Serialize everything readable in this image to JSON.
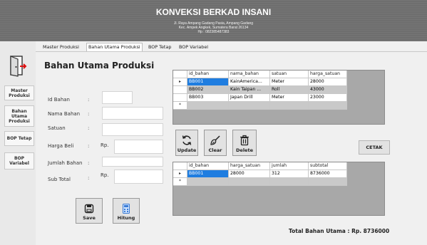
{
  "header": {
    "title": "KONVEKSI BERKAD INSANI",
    "address1": "Jl. Raya Ampang Gadang Pasia, Ampang Gadang",
    "address2": "Kec. Ampek Angkek, Sumatera Barat 26134",
    "phone": "Hp : 082385487383"
  },
  "tabs": [
    {
      "label": "Master Produksi"
    },
    {
      "label": "Bahan Utama Produksi"
    },
    {
      "label": "BOP Tetap"
    },
    {
      "label": "BOP Variabel"
    }
  ],
  "sidebar": {
    "exit_icon": "exit-door-icon",
    "items": [
      {
        "label": "Master Produksi"
      },
      {
        "label": "Bahan Utama Produksi"
      },
      {
        "label": "BOP Tetap"
      },
      {
        "label": "BOP Variabel"
      }
    ]
  },
  "form": {
    "title": "Bahan Utama Produksi",
    "fields": {
      "id_bahan": {
        "label": "Id Bahan",
        "value": ""
      },
      "nama_bahan": {
        "label": "Nama Bahan",
        "value": ""
      },
      "satuan": {
        "label": "Satuan",
        "value": ""
      },
      "harga_beli": {
        "label": "Harga Beli",
        "prefix": "Rp.",
        "value": ""
      },
      "jumlah_bahan": {
        "label": "Jumlah Bahan",
        "value": ""
      },
      "sub_total": {
        "label": "Sub Total",
        "prefix": "Rp.",
        "value": ""
      }
    },
    "colon": ":"
  },
  "buttons": {
    "save": {
      "label": "Save",
      "icon": "save-icon"
    },
    "hitung": {
      "label": "Hitung",
      "icon": "calculator-icon"
    },
    "update": {
      "label": "Update",
      "icon": "refresh-icon"
    },
    "clear": {
      "label": "Clear",
      "icon": "broom-icon"
    },
    "delete": {
      "label": "Delete",
      "icon": "trash-icon"
    },
    "cetak": {
      "label": "CETAK"
    }
  },
  "grid_bahan": {
    "columns": [
      "id_bahan",
      "nama_bahan",
      "satuan",
      "harga_satuan"
    ],
    "rows": [
      [
        "BB001",
        "KainAmerica...",
        "Meter",
        "28000"
      ],
      [
        "BB002",
        "Kain Taipan ...",
        "Roll",
        "43000"
      ],
      [
        "BB003",
        "Japan Drill",
        "Meter",
        "23000"
      ]
    ]
  },
  "grid_transaksi": {
    "columns": [
      "id_bahan",
      "harga_satuan",
      "jumlah",
      "subtotal"
    ],
    "rows": [
      [
        "BB001",
        "28000",
        "312",
        "8736000"
      ]
    ]
  },
  "row_indicator": {
    "current": "▸",
    "new": "*"
  },
  "total": {
    "label": "Total Bahan Utama : Rp. 8736000"
  },
  "colors": {
    "header_bg": "#6e6e6e",
    "selection": "#1f7de0",
    "panel_bg": "#f0f0f0"
  }
}
